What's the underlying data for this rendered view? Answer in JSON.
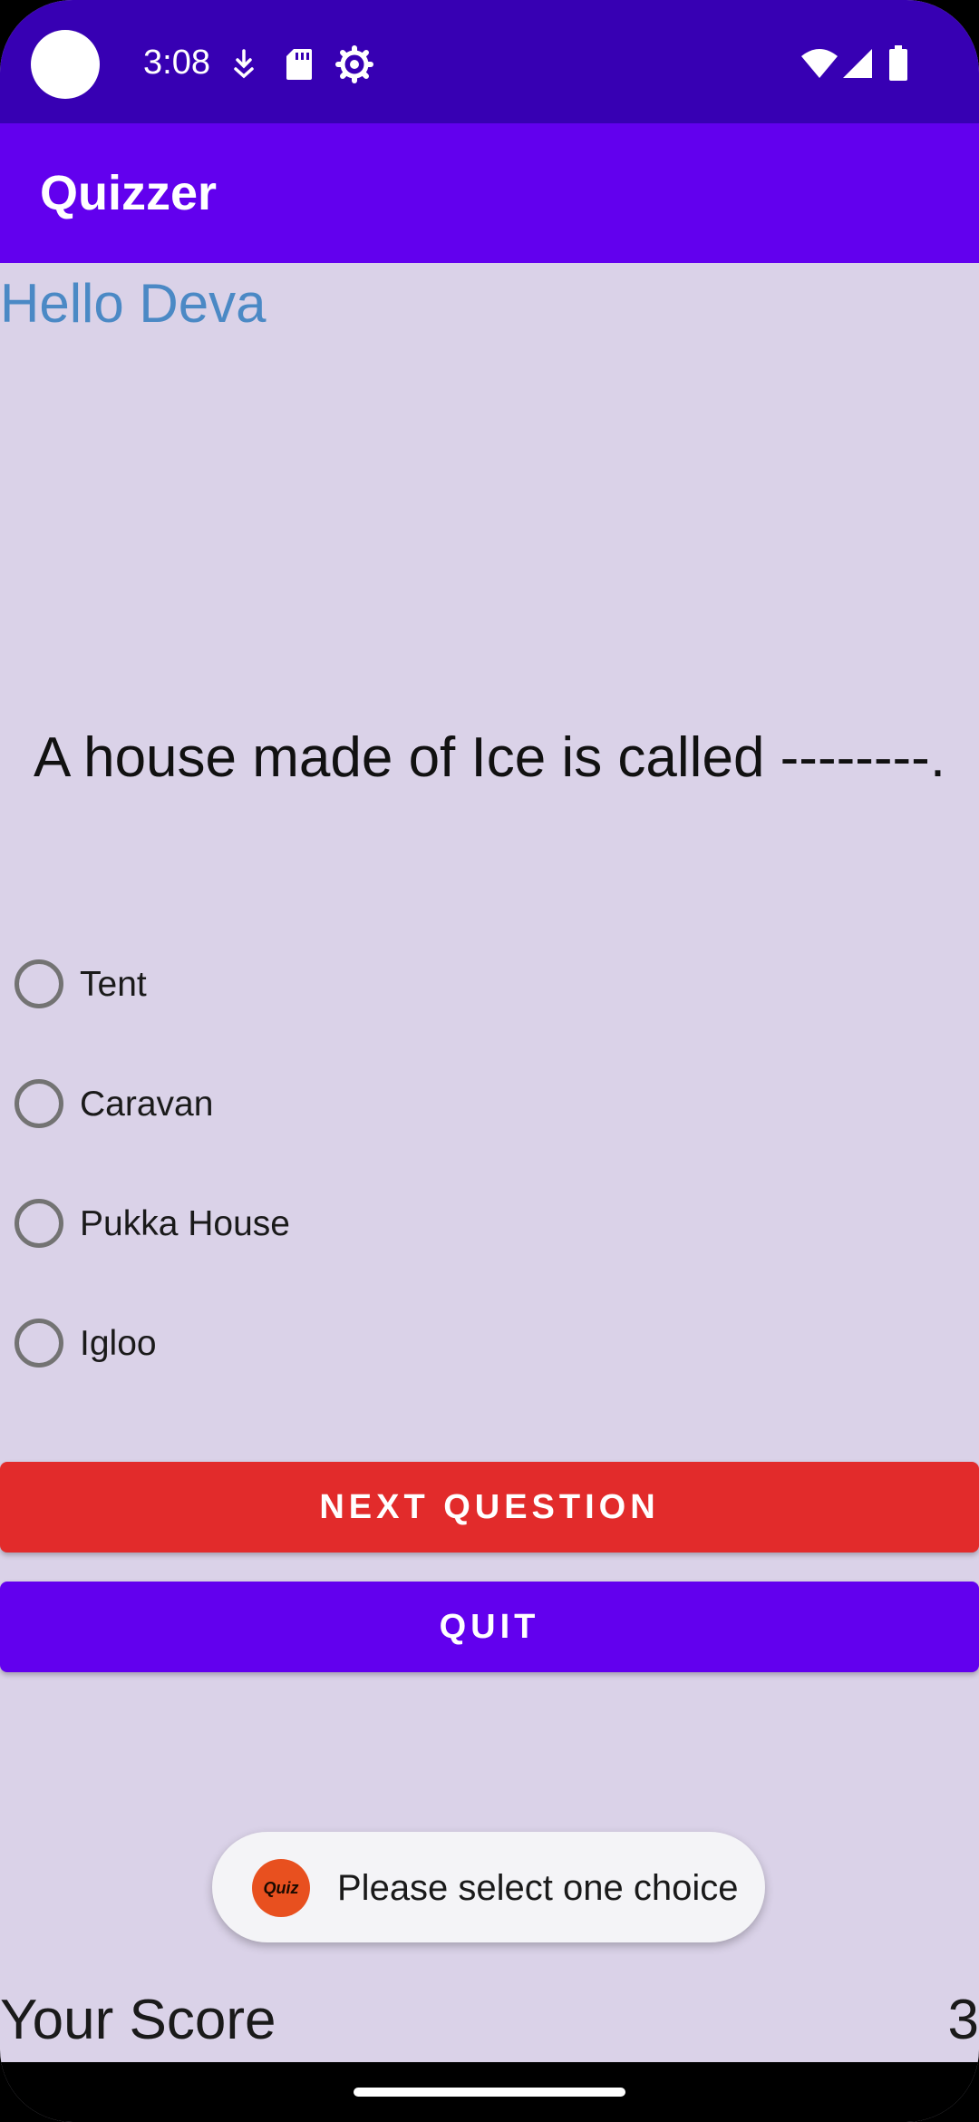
{
  "status_bar": {
    "time": "3:08",
    "icons_left": [
      "download-icon",
      "sd-card-icon",
      "settings-gear-icon"
    ],
    "icons_right": [
      "wifi-icon",
      "signal-icon",
      "battery-icon"
    ]
  },
  "app_bar": {
    "title": "Quizzer"
  },
  "greeting": "Hello Deva",
  "question": "A house made of Ice is called --------.",
  "options": [
    "Tent",
    "Caravan",
    "Pukka House",
    "Igloo"
  ],
  "buttons": {
    "next": "NEXT QUESTION",
    "quit": "QUIT"
  },
  "toast": {
    "message": "Please select one choice",
    "logo_text": "Quiz"
  },
  "score": {
    "label": "Your Score",
    "value": "3"
  },
  "colors": {
    "status_bar": "#3700b3",
    "app_bar": "#6200ee",
    "background": "#dad2e8",
    "next_button": "#e22b2b",
    "quit_button": "#6200ee",
    "greeting": "#4b89c5"
  }
}
